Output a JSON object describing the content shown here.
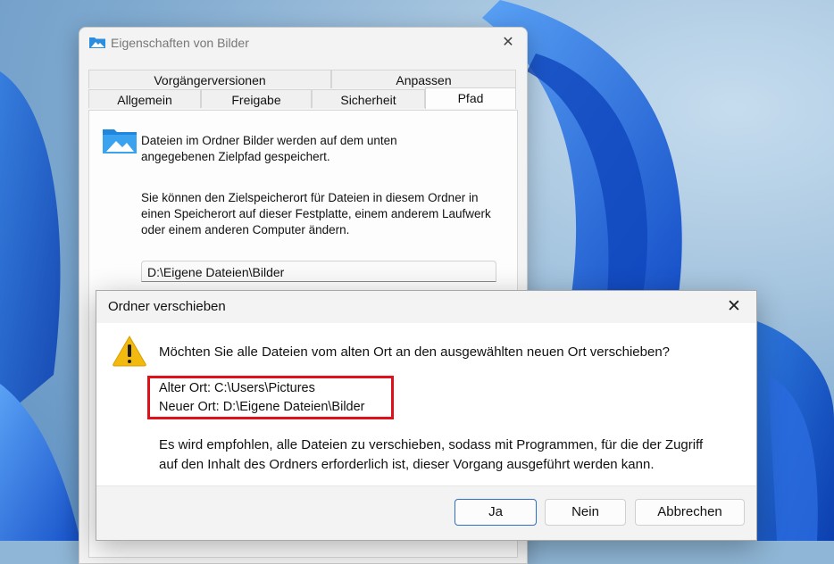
{
  "properties_window": {
    "title": "Eigenschaften von Bilder",
    "tabs_row1": [
      "Vorgängerversionen",
      "Anpassen"
    ],
    "tabs_row2": [
      "Allgemein",
      "Freigabe",
      "Sicherheit",
      "Pfad"
    ],
    "active_tab": "Pfad",
    "info_text_line1": "Dateien im Ordner Bilder werden auf dem unten",
    "info_text_line2": "angegebenen Zielpfad gespeichert.",
    "desc_line1": "Sie können den Zielspeicherort für Dateien in diesem Ordner in",
    "desc_line2": "einen Speicherort auf dieser Festplatte, einem anderem Laufwerk",
    "desc_line3": "oder einem anderen Computer ändern.",
    "path_value": "D:\\Eigene Dateien\\Bilder",
    "close_glyph": "✕"
  },
  "dialog": {
    "title": "Ordner verschieben",
    "close_glyph": "✕",
    "question": "Möchten Sie alle Dateien vom alten Ort an den ausgewählten neuen Ort verschieben?",
    "old_location": "Alter Ort: C:\\Users\\Pictures",
    "new_location": "Neuer Ort: D:\\Eigene Dateien\\Bilder",
    "recommend_line1": "Es wird empfohlen, alle Dateien zu verschieben, sodass mit Programmen, für die der Zugriff",
    "recommend_line2": "auf den Inhalt des Ordners erforderlich ist, dieser Vorgang ausgeführt werden kann.",
    "buttons": {
      "yes": "Ja",
      "no": "Nein",
      "cancel": "Abbrechen"
    },
    "warning_glyph": "!"
  },
  "colors": {
    "highlight": "#e0101b",
    "accent": "#2d6fc7",
    "warning": "#f2b90f"
  }
}
